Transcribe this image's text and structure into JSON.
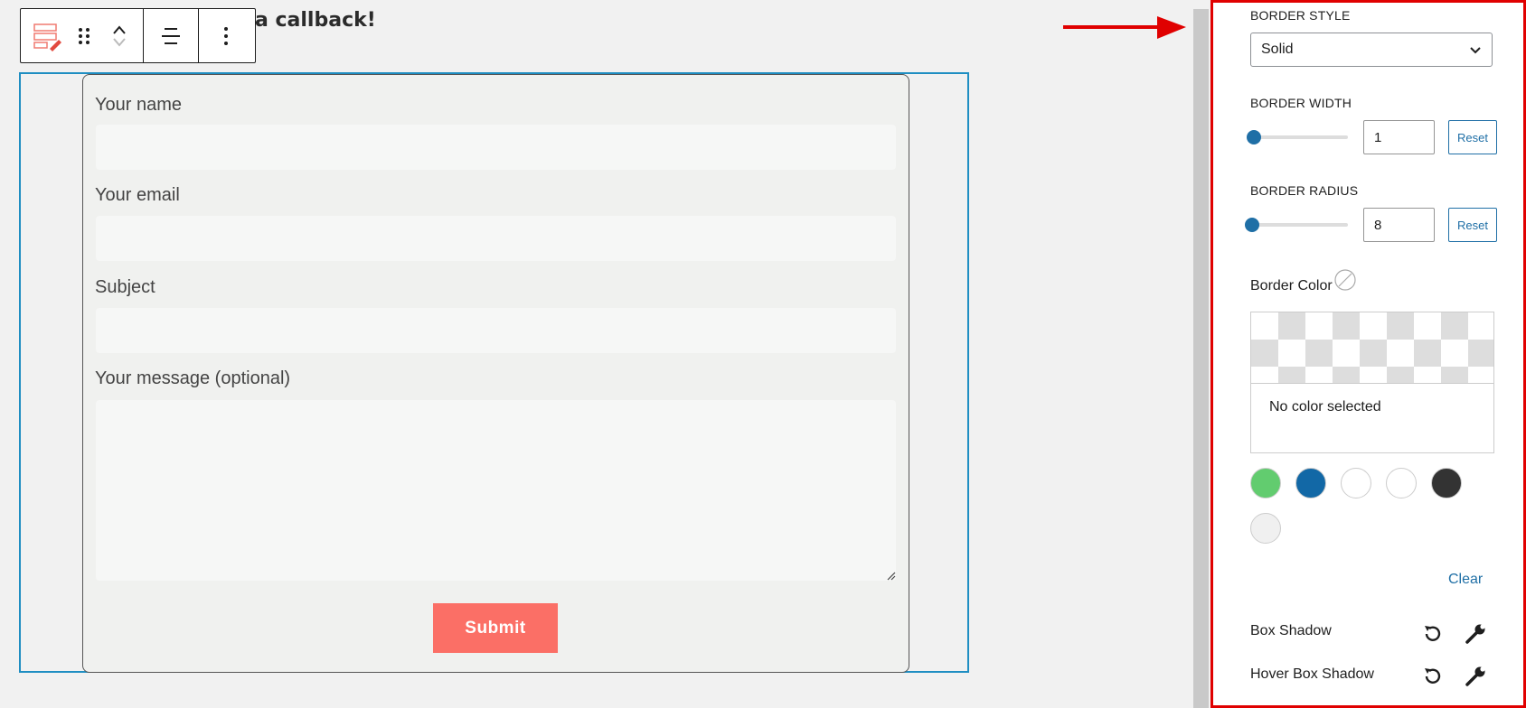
{
  "editor": {
    "heading_visible": "a callback!",
    "form": {
      "name_label": "Your name",
      "email_label": "Your email",
      "subject_label": "Subject",
      "message_label": "Your message (optional)",
      "submit_label": "Submit"
    }
  },
  "sidebar": {
    "border_style": {
      "label": "BORDER STYLE",
      "value": "Solid"
    },
    "border_width": {
      "label": "BORDER WIDTH",
      "value": "1",
      "reset_label": "Reset"
    },
    "border_radius": {
      "label": "BORDER RADIUS",
      "value": "8",
      "reset_label": "Reset"
    },
    "border_color": {
      "label": "Border Color",
      "status": "No color selected",
      "clear_label": "Clear",
      "swatches": [
        "#62cc6f",
        "#1268a6",
        "#ffffff",
        "#ffffff",
        "#333333",
        "#f0f0f0"
      ]
    },
    "box_shadow_label": "Box Shadow",
    "hover_box_shadow_label": "Hover Box Shadow"
  },
  "colors": {
    "accent": "#1f6fa6",
    "selection_outline": "#1f8ec2",
    "submit": "#fb6f66",
    "highlight_border": "#e00000"
  },
  "icons": [
    "block-type-icon",
    "drag-handle-icon",
    "move-up-icon",
    "move-down-icon",
    "align-icon",
    "more-options-icon",
    "chevron-down-icon",
    "no-color-icon",
    "reset-icon",
    "wrench-icon",
    "annotation-arrow-icon"
  ]
}
